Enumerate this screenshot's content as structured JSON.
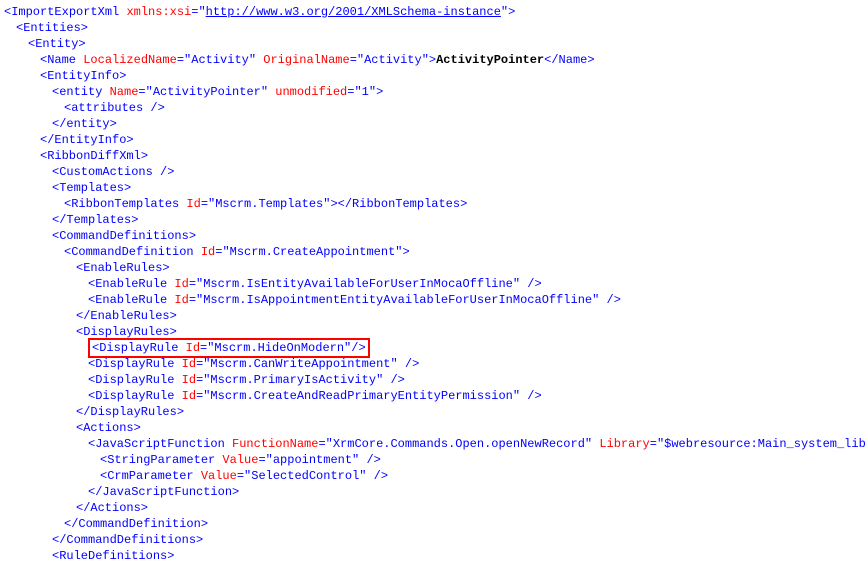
{
  "lines": [
    {
      "indent": 0,
      "segments": [
        {
          "type": "tag",
          "text": "<"
        },
        {
          "type": "tag",
          "text": "ImportExportXml"
        },
        {
          "type": "text",
          "text": " "
        },
        {
          "type": "attr-name",
          "text": "xmlns:xsi"
        },
        {
          "type": "tag",
          "text": "=\""
        },
        {
          "type": "string-link",
          "text": "http://www.w3.org/2001/XMLSchema-instance"
        },
        {
          "type": "tag",
          "text": "\">"
        }
      ]
    },
    {
      "indent": 1,
      "segments": [
        {
          "type": "tag",
          "text": "<Entities>"
        }
      ]
    },
    {
      "indent": 2,
      "segments": [
        {
          "type": "tag",
          "text": "<Entity>"
        }
      ]
    },
    {
      "indent": 3,
      "segments": [
        {
          "type": "tag",
          "text": "<Name "
        },
        {
          "type": "attr-name",
          "text": "LocalizedName"
        },
        {
          "type": "tag",
          "text": "="
        },
        {
          "type": "attr-value",
          "text": "\"Activity\""
        },
        {
          "type": "text",
          "text": " "
        },
        {
          "type": "attr-name",
          "text": "OriginalName"
        },
        {
          "type": "tag",
          "text": "="
        },
        {
          "type": "attr-value",
          "text": "\"Activity\""
        },
        {
          "type": "tag",
          "text": ">"
        },
        {
          "type": "text",
          "text": "ActivityPointer"
        },
        {
          "type": "tag",
          "text": "</Name>"
        }
      ]
    },
    {
      "indent": 3,
      "segments": [
        {
          "type": "tag",
          "text": "<EntityInfo>"
        }
      ]
    },
    {
      "indent": 4,
      "segments": [
        {
          "type": "tag",
          "text": "<entity "
        },
        {
          "type": "attr-name",
          "text": "Name"
        },
        {
          "type": "tag",
          "text": "="
        },
        {
          "type": "attr-value",
          "text": "\"ActivityPointer\""
        },
        {
          "type": "text",
          "text": " "
        },
        {
          "type": "attr-name",
          "text": "unmodified"
        },
        {
          "type": "tag",
          "text": "="
        },
        {
          "type": "attr-value",
          "text": "\"1\""
        },
        {
          "type": "tag",
          "text": ">"
        }
      ]
    },
    {
      "indent": 5,
      "segments": [
        {
          "type": "tag",
          "text": "<attributes />"
        }
      ]
    },
    {
      "indent": 4,
      "segments": [
        {
          "type": "tag",
          "text": "</entity>"
        }
      ]
    },
    {
      "indent": 3,
      "segments": [
        {
          "type": "tag",
          "text": "</EntityInfo>"
        }
      ]
    },
    {
      "indent": 3,
      "segments": [
        {
          "type": "tag",
          "text": "<RibbonDiffXml>"
        }
      ]
    },
    {
      "indent": 4,
      "segments": [
        {
          "type": "tag",
          "text": "<CustomActions />"
        }
      ]
    },
    {
      "indent": 4,
      "segments": [
        {
          "type": "tag",
          "text": "<Templates>"
        }
      ]
    },
    {
      "indent": 5,
      "segments": [
        {
          "type": "tag",
          "text": "<RibbonTemplates "
        },
        {
          "type": "attr-name",
          "text": "Id"
        },
        {
          "type": "tag",
          "text": "="
        },
        {
          "type": "attr-value",
          "text": "\"Mscrm.Templates\""
        },
        {
          "type": "tag",
          "text": "></RibbonTemplates>"
        }
      ]
    },
    {
      "indent": 4,
      "segments": [
        {
          "type": "tag",
          "text": "</Templates>"
        }
      ]
    },
    {
      "indent": 4,
      "segments": [
        {
          "type": "tag",
          "text": "<CommandDefinitions>"
        }
      ]
    },
    {
      "indent": 5,
      "segments": [
        {
          "type": "tag",
          "text": "<CommandDefinition "
        },
        {
          "type": "attr-name",
          "text": "Id"
        },
        {
          "type": "tag",
          "text": "="
        },
        {
          "type": "attr-value",
          "text": "\"Mscrm.CreateAppointment\""
        },
        {
          "type": "tag",
          "text": ">"
        }
      ]
    },
    {
      "indent": 6,
      "segments": [
        {
          "type": "tag",
          "text": "<EnableRules>"
        }
      ]
    },
    {
      "indent": 7,
      "segments": [
        {
          "type": "tag",
          "text": "<EnableRule "
        },
        {
          "type": "attr-name",
          "text": "Id"
        },
        {
          "type": "tag",
          "text": "="
        },
        {
          "type": "attr-value",
          "text": "\"Mscrm.IsEntityAvailableForUserInMocaOffline\""
        },
        {
          "type": "tag",
          "text": " />"
        }
      ]
    },
    {
      "indent": 7,
      "segments": [
        {
          "type": "tag",
          "text": "<EnableRule "
        },
        {
          "type": "attr-name",
          "text": "Id"
        },
        {
          "type": "tag",
          "text": "="
        },
        {
          "type": "attr-value",
          "text": "\"Mscrm.IsAppointmentEntityAvailableForUserInMocaOffline\""
        },
        {
          "type": "tag",
          "text": " />"
        }
      ]
    },
    {
      "indent": 6,
      "segments": [
        {
          "type": "tag",
          "text": "</EnableRules>"
        }
      ]
    },
    {
      "indent": 6,
      "segments": [
        {
          "type": "tag",
          "text": "<DisplayRules>"
        }
      ]
    },
    {
      "indent": 7,
      "highlight": true,
      "segments": [
        {
          "type": "tag",
          "text": "<DisplayRule "
        },
        {
          "type": "attr-name",
          "text": "Id"
        },
        {
          "type": "tag",
          "text": "="
        },
        {
          "type": "attr-value",
          "text": "\"Mscrm.HideOnModern\""
        },
        {
          "type": "tag",
          "text": "/>"
        }
      ]
    },
    {
      "indent": 7,
      "segments": [
        {
          "type": "tag",
          "text": "<DisplayRule "
        },
        {
          "type": "attr-name",
          "text": "Id"
        },
        {
          "type": "tag",
          "text": "="
        },
        {
          "type": "attr-value",
          "text": "\"Mscrm.CanWriteAppointment\""
        },
        {
          "type": "tag",
          "text": " />"
        }
      ]
    },
    {
      "indent": 7,
      "segments": [
        {
          "type": "tag",
          "text": "<DisplayRule "
        },
        {
          "type": "attr-name",
          "text": "Id"
        },
        {
          "type": "tag",
          "text": "="
        },
        {
          "type": "attr-value",
          "text": "\"Mscrm.PrimaryIsActivity\""
        },
        {
          "type": "tag",
          "text": " />"
        }
      ]
    },
    {
      "indent": 7,
      "segments": [
        {
          "type": "tag",
          "text": "<DisplayRule "
        },
        {
          "type": "attr-name",
          "text": "Id"
        },
        {
          "type": "tag",
          "text": "="
        },
        {
          "type": "attr-value",
          "text": "\"Mscrm.CreateAndReadPrimaryEntityPermission\""
        },
        {
          "type": "tag",
          "text": " />"
        }
      ]
    },
    {
      "indent": 6,
      "segments": [
        {
          "type": "tag",
          "text": "</DisplayRules>"
        }
      ]
    },
    {
      "indent": 6,
      "segments": [
        {
          "type": "tag",
          "text": "<Actions>"
        }
      ]
    },
    {
      "indent": 7,
      "segments": [
        {
          "type": "tag",
          "text": "<JavaScriptFunction "
        },
        {
          "type": "attr-name",
          "text": "FunctionName"
        },
        {
          "type": "tag",
          "text": "="
        },
        {
          "type": "attr-value",
          "text": "\"XrmCore.Commands.Open.openNewRecord\""
        },
        {
          "type": "text",
          "text": " "
        },
        {
          "type": "attr-name",
          "text": "Library"
        },
        {
          "type": "tag",
          "text": "="
        },
        {
          "type": "attr-value",
          "text": "\"$webresource:Main_system_library.js\""
        },
        {
          "type": "tag",
          "text": ">"
        }
      ]
    },
    {
      "indent": 8,
      "segments": [
        {
          "type": "tag",
          "text": "<StringParameter "
        },
        {
          "type": "attr-name",
          "text": "Value"
        },
        {
          "type": "tag",
          "text": "="
        },
        {
          "type": "attr-value",
          "text": "\"appointment\""
        },
        {
          "type": "tag",
          "text": " />"
        }
      ]
    },
    {
      "indent": 8,
      "segments": [
        {
          "type": "tag",
          "text": "<CrmParameter "
        },
        {
          "type": "attr-name",
          "text": "Value"
        },
        {
          "type": "tag",
          "text": "="
        },
        {
          "type": "attr-value",
          "text": "\"SelectedControl\""
        },
        {
          "type": "tag",
          "text": " />"
        }
      ]
    },
    {
      "indent": 7,
      "segments": [
        {
          "type": "tag",
          "text": "</JavaScriptFunction>"
        }
      ]
    },
    {
      "indent": 6,
      "segments": [
        {
          "type": "tag",
          "text": "</Actions>"
        }
      ]
    },
    {
      "indent": 5,
      "segments": [
        {
          "type": "tag",
          "text": "</CommandDefinition>"
        }
      ]
    },
    {
      "indent": 4,
      "segments": [
        {
          "type": "tag",
          "text": "</CommandDefinitions>"
        }
      ]
    },
    {
      "indent": 4,
      "segments": [
        {
          "type": "tag",
          "text": "<RuleDefinitions>"
        }
      ]
    }
  ]
}
